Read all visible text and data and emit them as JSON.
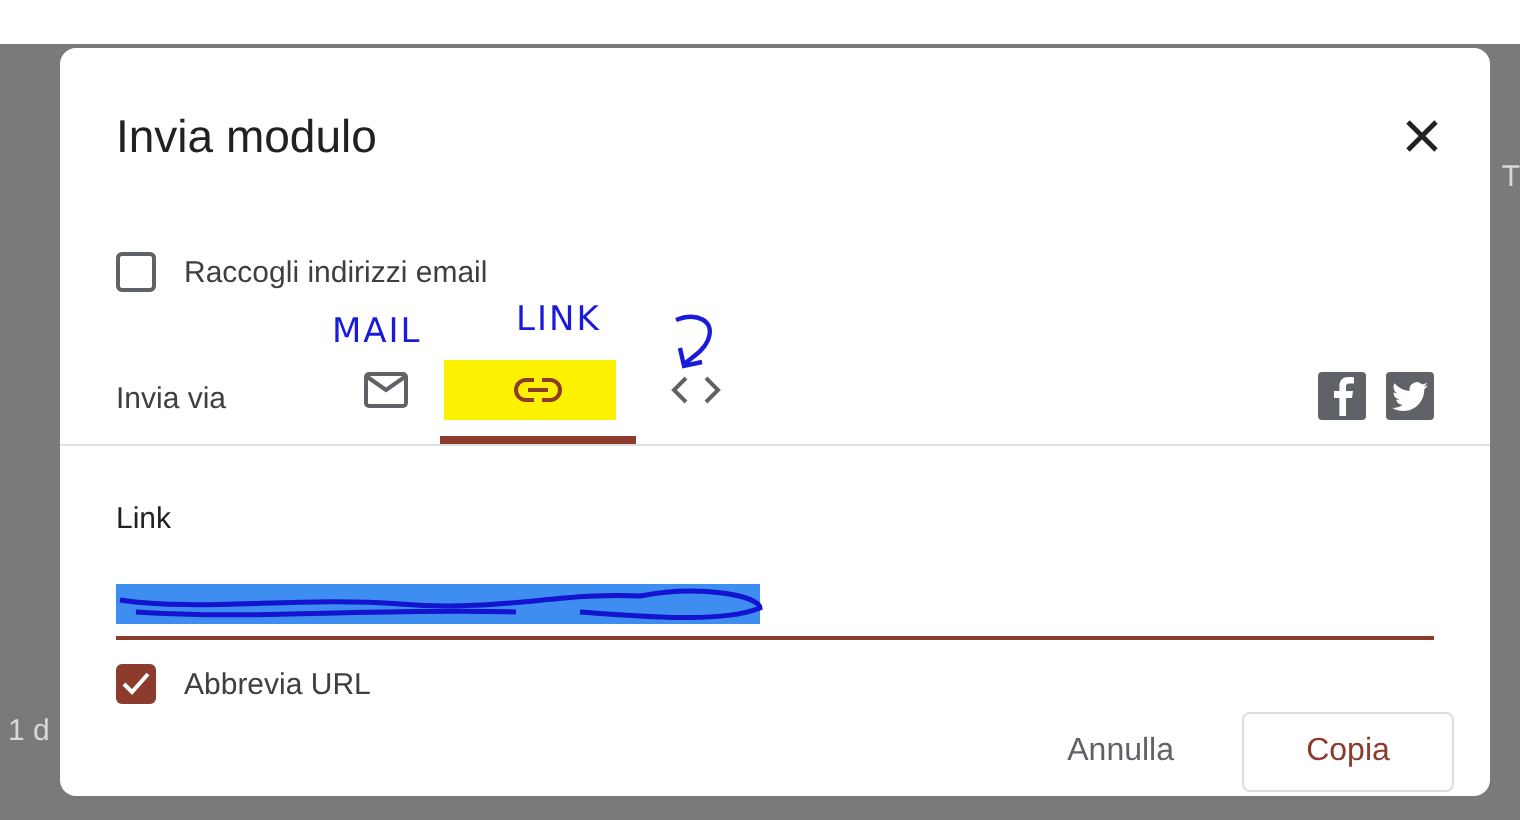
{
  "backdrop": {
    "edge_text_right": "T",
    "edge_text_left": "1 d"
  },
  "dialog": {
    "title": "Invia modulo",
    "collect_emails": {
      "label": "Raccogli indirizzi email",
      "checked": false
    },
    "send_via": {
      "label": "Invia via",
      "methods": [
        {
          "kind": "mail",
          "selected": false
        },
        {
          "kind": "link",
          "selected": true
        },
        {
          "kind": "embed",
          "selected": false
        }
      ],
      "social": [
        {
          "kind": "facebook"
        },
        {
          "kind": "twitter"
        }
      ]
    },
    "link_section": {
      "label": "Link",
      "shorten_url": {
        "label": "Abbrevia URL",
        "checked": true
      }
    },
    "buttons": [
      {
        "label": "Annulla",
        "kind": "text"
      },
      {
        "label": "Copia",
        "kind": "outlined"
      }
    ]
  },
  "annotations": [
    {
      "text": "MAIL"
    },
    {
      "text": "LINK"
    }
  ]
}
